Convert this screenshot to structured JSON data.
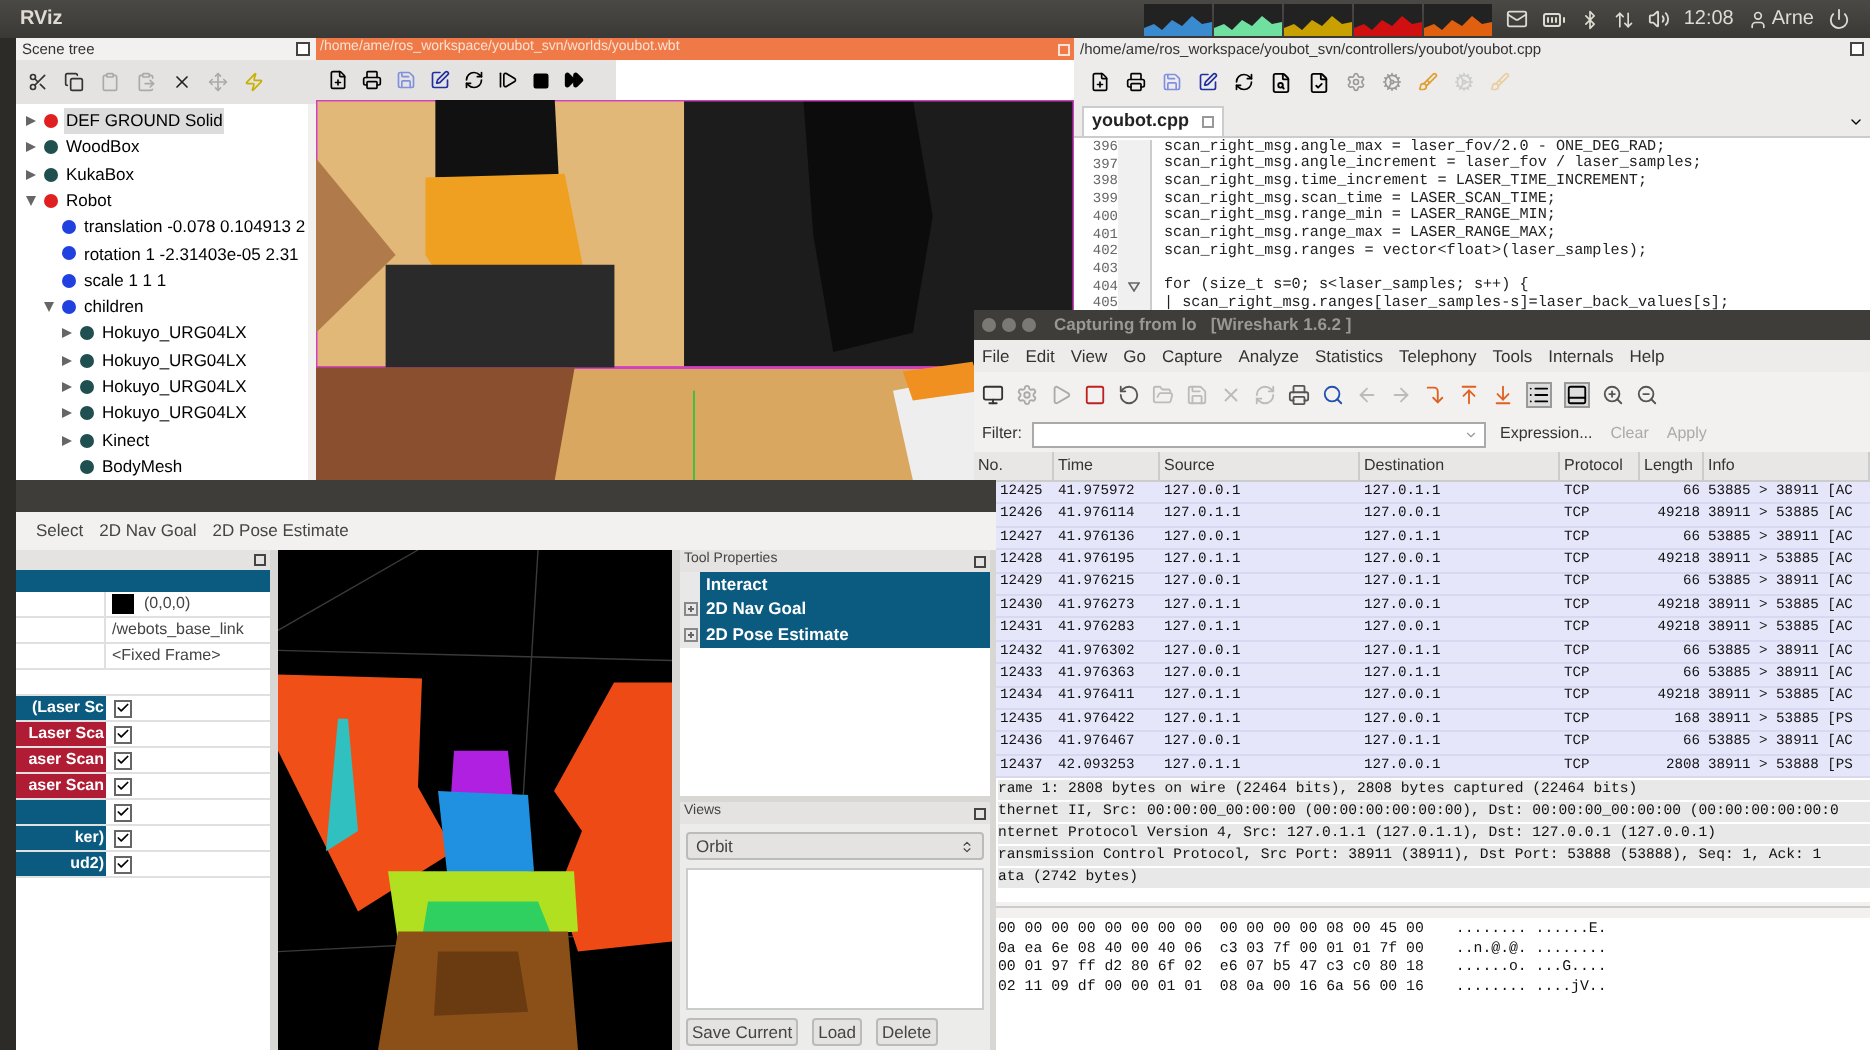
{
  "top_panel": {
    "app_title": "RViz",
    "clock": "12:08",
    "user": "Arne"
  },
  "scene_tree": {
    "title": "Scene tree",
    "items": [
      {
        "label": "DEF GROUND Solid",
        "kind": "node",
        "color": "#e02020",
        "expanded": false,
        "selected": true
      },
      {
        "label": "WoodBox",
        "kind": "node",
        "color": "#1f4f4f",
        "expanded": false,
        "selected": false
      },
      {
        "label": "KukaBox",
        "kind": "node",
        "color": "#1f4f4f",
        "expanded": false,
        "selected": false
      },
      {
        "label": "Robot",
        "kind": "node",
        "color": "#e02020",
        "expanded": true,
        "selected": false,
        "children": [
          {
            "label": "translation -0.078 0.104913 2",
            "kind": "leaf",
            "color": "#2040e0",
            "selected": false
          },
          {
            "label": "rotation 1 -2.31403e-05 2.31",
            "kind": "leaf",
            "color": "#2040e0",
            "selected": false
          },
          {
            "label": "scale 1 1 1",
            "kind": "leaf",
            "color": "#2040e0",
            "selected": false
          },
          {
            "label": "children",
            "kind": "node",
            "color": "#2040e0",
            "expanded": true,
            "selected": false,
            "children": [
              {
                "label": "Hokuyo_URG04LX",
                "kind": "node",
                "color": "#1f4f4f",
                "expanded": false,
                "selected": false
              },
              {
                "label": "Hokuyo_URG04LX",
                "kind": "node",
                "color": "#1f4f4f",
                "expanded": false,
                "selected": false
              },
              {
                "label": "Hokuyo_URG04LX",
                "kind": "node",
                "color": "#1f4f4f",
                "expanded": false,
                "selected": false
              },
              {
                "label": "Hokuyo_URG04LX",
                "kind": "node",
                "color": "#1f4f4f",
                "expanded": false,
                "selected": false
              },
              {
                "label": "Kinect",
                "kind": "node",
                "color": "#1f4f4f",
                "expanded": false,
                "selected": false
              },
              {
                "label": "BodyMesh",
                "kind": "leaf",
                "color": "#1f4f4f",
                "selected": false
              }
            ]
          }
        ]
      }
    ]
  },
  "simulator": {
    "title": "/home/ame/ros_workspace/youbot_svn/worlds/youbot.wbt"
  },
  "editor": {
    "title": "/home/ame/ros_workspace/youbot_svn/controllers/youbot/youbot.cpp",
    "tab": "youbot.cpp",
    "lines": [
      {
        "number": "396",
        "code": "scan_right_msg.angle_max = laser_fov/2.0 - ONE_DEG_RAD;",
        "foldable": false
      },
      {
        "number": "397",
        "code": "scan_right_msg.angle_increment = laser_fov / laser_samples;",
        "foldable": false
      },
      {
        "number": "398",
        "code": "scan_right_msg.time_increment = LASER_TIME_INCREMENT;",
        "foldable": false
      },
      {
        "number": "399",
        "code": "scan_right_msg.scan_time = LASER_SCAN_TIME;",
        "foldable": false
      },
      {
        "number": "400",
        "code": "scan_right_msg.range_min = LASER_RANGE_MIN;",
        "foldable": false
      },
      {
        "number": "401",
        "code": "scan_right_msg.range_max = LASER_RANGE_MAX;",
        "foldable": false
      },
      {
        "number": "402",
        "code": "scan_right_msg.ranges = vector<float>(laser_samples);",
        "foldable": false
      },
      {
        "number": "403",
        "foldable": false
      },
      {
        "number": "404",
        "code": "for (size_t s=0; s<laser_samples; s++) {",
        "foldable": true
      },
      {
        "number": "405",
        "code": "| scan_right_msg.ranges[laser_samples-s]=laser_back_values[s];",
        "foldable": false
      }
    ]
  },
  "wireshark": {
    "title": "Capturing from lo   [Wireshark 1.6.2 ]",
    "menu": [
      "File",
      "Edit",
      "View",
      "Go",
      "Capture",
      "Analyze",
      "Statistics",
      "Telephony",
      "Tools",
      "Internals",
      "Help"
    ],
    "filter": {
      "label": "Filter:",
      "buttons": [
        {
          "label": "Expression...",
          "disabled": false
        },
        {
          "label": "Clear",
          "disabled": true
        },
        {
          "label": "Apply",
          "disabled": true
        }
      ]
    },
    "columns": [
      "No.",
      "Time",
      "Source",
      "Destination",
      "Protocol",
      "Length",
      "Info"
    ],
    "rows": [
      [
        "12425",
        "41.975972",
        "127.0.0.1",
        "127.0.1.1",
        "TCP",
        "66",
        "53885 > 38911 [AC"
      ],
      [
        "12426",
        "41.976114",
        "127.0.1.1",
        "127.0.0.1",
        "TCP",
        "49218",
        "38911 > 53885 [AC"
      ],
      [
        "12427",
        "41.976136",
        "127.0.0.1",
        "127.0.1.1",
        "TCP",
        "66",
        "53885 > 38911 [AC"
      ],
      [
        "12428",
        "41.976195",
        "127.0.1.1",
        "127.0.0.1",
        "TCP",
        "49218",
        "38911 > 53885 [AC"
      ],
      [
        "12429",
        "41.976215",
        "127.0.0.1",
        "127.0.1.1",
        "TCP",
        "66",
        "53885 > 38911 [AC"
      ],
      [
        "12430",
        "41.976273",
        "127.0.1.1",
        "127.0.0.1",
        "TCP",
        "49218",
        "38911 > 53885 [AC"
      ],
      [
        "12431",
        "41.976283",
        "127.0.1.1",
        "127.0.0.1",
        "TCP",
        "49218",
        "38911 > 53885 [AC"
      ],
      [
        "12432",
        "41.976302",
        "127.0.0.1",
        "127.0.1.1",
        "TCP",
        "66",
        "53885 > 38911 [AC"
      ],
      [
        "12433",
        "41.976363",
        "127.0.0.1",
        "127.0.1.1",
        "TCP",
        "66",
        "53885 > 38911 [AC"
      ],
      [
        "12434",
        "41.976411",
        "127.0.1.1",
        "127.0.0.1",
        "TCP",
        "49218",
        "38911 > 53885 [AC"
      ],
      [
        "12435",
        "41.976422",
        "127.0.1.1",
        "127.0.0.1",
        "TCP",
        "168",
        "38911 > 53885 [PS"
      ],
      [
        "12436",
        "41.976467",
        "127.0.0.1",
        "127.0.1.1",
        "TCP",
        "66",
        "53885 > 38911 [AC"
      ],
      [
        "12437",
        "42.093253",
        "127.0.1.1",
        "127.0.0.1",
        "TCP",
        "2808",
        "38911 > 53888 [PS"
      ]
    ],
    "details": [
      "rame 1: 2808 bytes on wire (22464 bits), 2808 bytes captured (22464 bits)",
      "thernet II, Src: 00:00:00_00:00:00 (00:00:00:00:00:00), Dst: 00:00:00_00:00:00 (00:00:00:00:00:0",
      "nternet Protocol Version 4, Src: 127.0.1.1 (127.0.1.1), Dst: 127.0.0.1 (127.0.0.1)",
      "ransmission Control Protocol, Src Port: 38911 (38911), Dst Port: 53888 (53888), Seq: 1, Ack: 1",
      "ata (2742 bytes)"
    ],
    "hex": [
      {
        "bytes": "00 00 00 00 00 00 00 00  00 00 00 00 08 00 45 00",
        "ascii": "........ ......E."
      },
      {
        "bytes": "0a ea 6e 08 40 00 40 06  c3 03 7f 00 01 01 7f 00",
        "ascii": "..n.@.@. ........"
      },
      {
        "bytes": "00 01 97 ff d2 80 6f 02  e6 07 b5 47 c3 c0 80 18",
        "ascii": "......o. ...G...."
      },
      {
        "bytes": "02 11 09 df 00 00 01 01  08 0a 00 16 6a 56 00 16",
        "ascii": "........ ....jV.."
      }
    ]
  },
  "rviz": {
    "tools": [
      "Select",
      "2D Nav Goal",
      "2D Pose Estimate"
    ],
    "properties": [
      {
        "value": "(0,0,0)",
        "color": "#000000"
      },
      {
        "value": "/webots_base_link"
      },
      {
        "value": "<Fixed Frame>"
      }
    ],
    "displays": [
      {
        "label": "(Laser Sc",
        "color": "#0b5a80",
        "checked": true
      },
      {
        "label": "Laser Sca",
        "color": "#b01c34",
        "checked": true
      },
      {
        "label": "aser Scan",
        "color": "#b01c34",
        "checked": true
      },
      {
        "label": "aser Scan",
        "color": "#b01c34",
        "checked": true
      },
      {
        "color": "#0b5a80",
        "checked": true
      },
      {
        "label": "ker)",
        "color": "#0b5a80",
        "checked": true
      },
      {
        "label": "ud2)",
        "color": "#0b5a80",
        "checked": true
      }
    ],
    "tool_properties": {
      "title": "Tool Properties",
      "items": [
        {
          "label": "Interact",
          "kind": "plain"
        },
        {
          "label": "2D Nav Goal",
          "kind": "group"
        },
        {
          "label": "2D Pose Estimate",
          "kind": "group"
        }
      ]
    },
    "views": {
      "title": "Views",
      "view_type": "Orbit",
      "buttons": [
        "Save Current",
        "Load",
        "Delete"
      ]
    }
  }
}
